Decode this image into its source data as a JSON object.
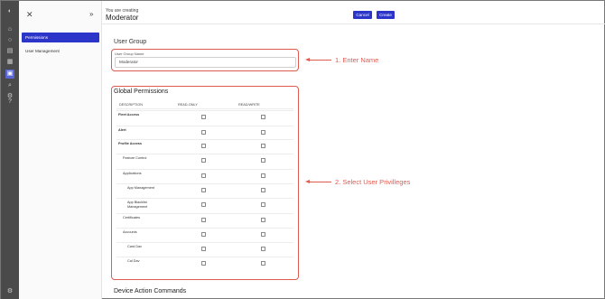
{
  "header": {
    "subtitle": "You are creating",
    "title": "Moderator",
    "cancel_label": "Cancel",
    "create_label": "Create"
  },
  "sidebar": {
    "items": [
      {
        "label": "Permissions",
        "active": true
      },
      {
        "label": "User Management",
        "active": false
      }
    ]
  },
  "user_group": {
    "section_title": "User Group",
    "field_label": "User Group Name",
    "field_value": "Moderator"
  },
  "global_permissions": {
    "title": "Global Permissions",
    "columns": [
      "DESCRIPTION",
      "READ-ONLY",
      "READ/WRITE"
    ],
    "rows": [
      {
        "label": "Fleet Access",
        "bold": true,
        "indent": 0
      },
      {
        "label": "Alert",
        "bold": true,
        "indent": 0
      },
      {
        "label": "Profile Access",
        "bold": true,
        "indent": 0
      },
      {
        "label": "Feature Control",
        "bold": false,
        "indent": 1
      },
      {
        "label": "Applications",
        "bold": false,
        "indent": 1
      },
      {
        "label": "App Management",
        "bold": false,
        "indent": 2
      },
      {
        "label": "App Blacklist Management",
        "bold": false,
        "indent": 2
      },
      {
        "label": "Certificates",
        "bold": false,
        "indent": 1
      },
      {
        "label": "Accounts",
        "bold": false,
        "indent": 1
      },
      {
        "label": "Card Dav",
        "bold": false,
        "indent": 2
      },
      {
        "label": "Cal Dav",
        "bold": false,
        "indent": 2
      }
    ]
  },
  "device_actions": {
    "title": "Device Action Commands"
  },
  "annotations": {
    "step1": "1. Enter Name",
    "step2": "2. Select User Privilleges",
    "color": "#e05a4f"
  },
  "colors": {
    "accent": "#2c35c9",
    "rail": "#4a4a4a"
  }
}
